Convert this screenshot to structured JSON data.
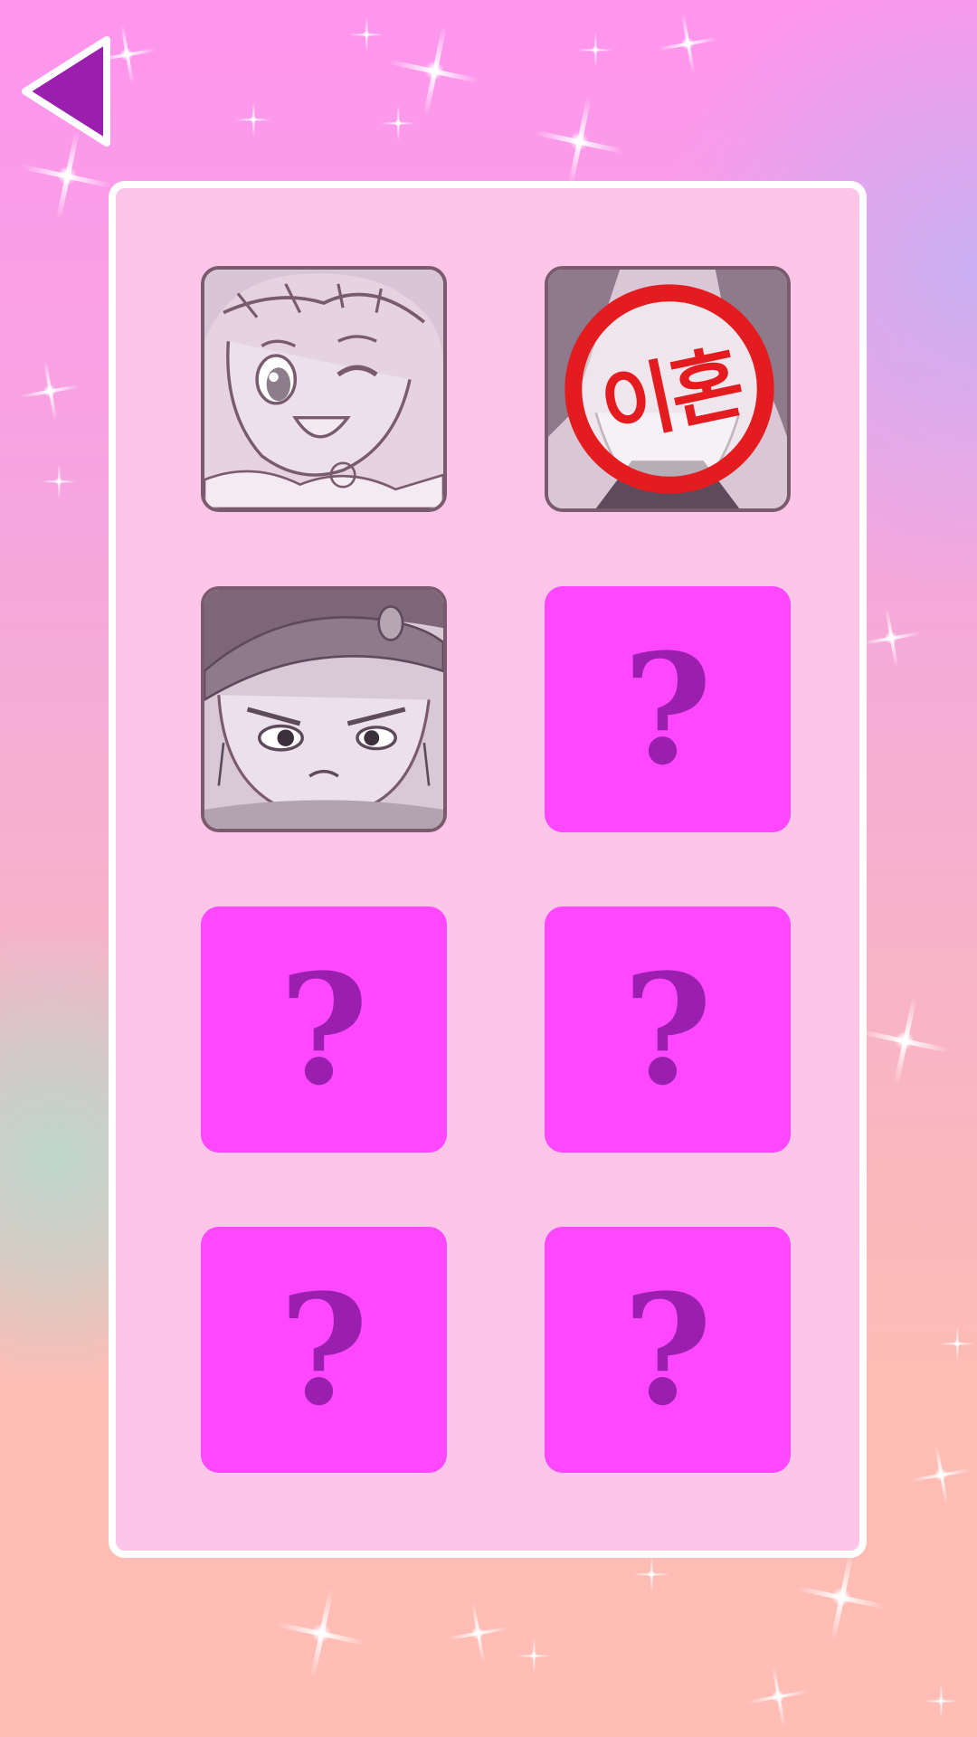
{
  "colors": {
    "panel": "#fdc5e8",
    "panel_border": "#ffffff",
    "hidden_card": "#ff47ff",
    "question_mark": "#9b1fae",
    "back_arrow": "#9b1fae",
    "revealed_card_border": "#7a5b6e",
    "stamp_red": "#e41b1f"
  },
  "back_button": {
    "icon": "triangle-left-icon"
  },
  "cards": [
    {
      "state": "revealed",
      "icon": "winking-character-portrait"
    },
    {
      "state": "revealed",
      "icon": "divorce-stamp-character-portrait",
      "stamp_text": "이혼"
    },
    {
      "state": "revealed",
      "icon": "frowning-character-portrait"
    },
    {
      "state": "hidden",
      "label": "?"
    },
    {
      "state": "hidden",
      "label": "?"
    },
    {
      "state": "hidden",
      "label": "?"
    },
    {
      "state": "hidden",
      "label": "?"
    },
    {
      "state": "hidden",
      "label": "?"
    }
  ]
}
